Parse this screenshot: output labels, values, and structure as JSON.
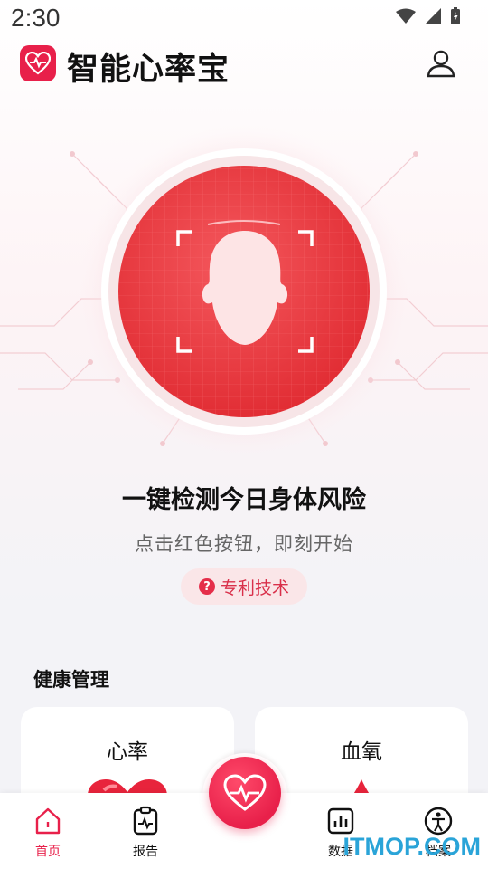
{
  "status_bar": {
    "time": "2:30"
  },
  "header": {
    "title": "智能心率宝"
  },
  "scan": {
    "title": "一键检测今日身体风险",
    "subtitle": "点击红色按钮，即刻开始",
    "patent_label": "专利技术"
  },
  "health": {
    "section_title": "健康管理",
    "cards": [
      {
        "label": "心率",
        "icon": "heart-icon"
      },
      {
        "label": "血氧",
        "icon": "blood-drop-icon"
      }
    ]
  },
  "tabbar": {
    "items": [
      {
        "label": "首页",
        "icon": "home-icon",
        "active": true
      },
      {
        "label": "报告",
        "icon": "report-icon",
        "active": false
      },
      {
        "label": "数据",
        "icon": "data-icon",
        "active": false
      },
      {
        "label": "档案",
        "icon": "person-icon",
        "active": false
      }
    ],
    "center_icon": "heartbeat-icon"
  },
  "watermark": "ITMOP.COM",
  "colors": {
    "accent": "#e8204a",
    "watermark": "#2aa4d8"
  }
}
